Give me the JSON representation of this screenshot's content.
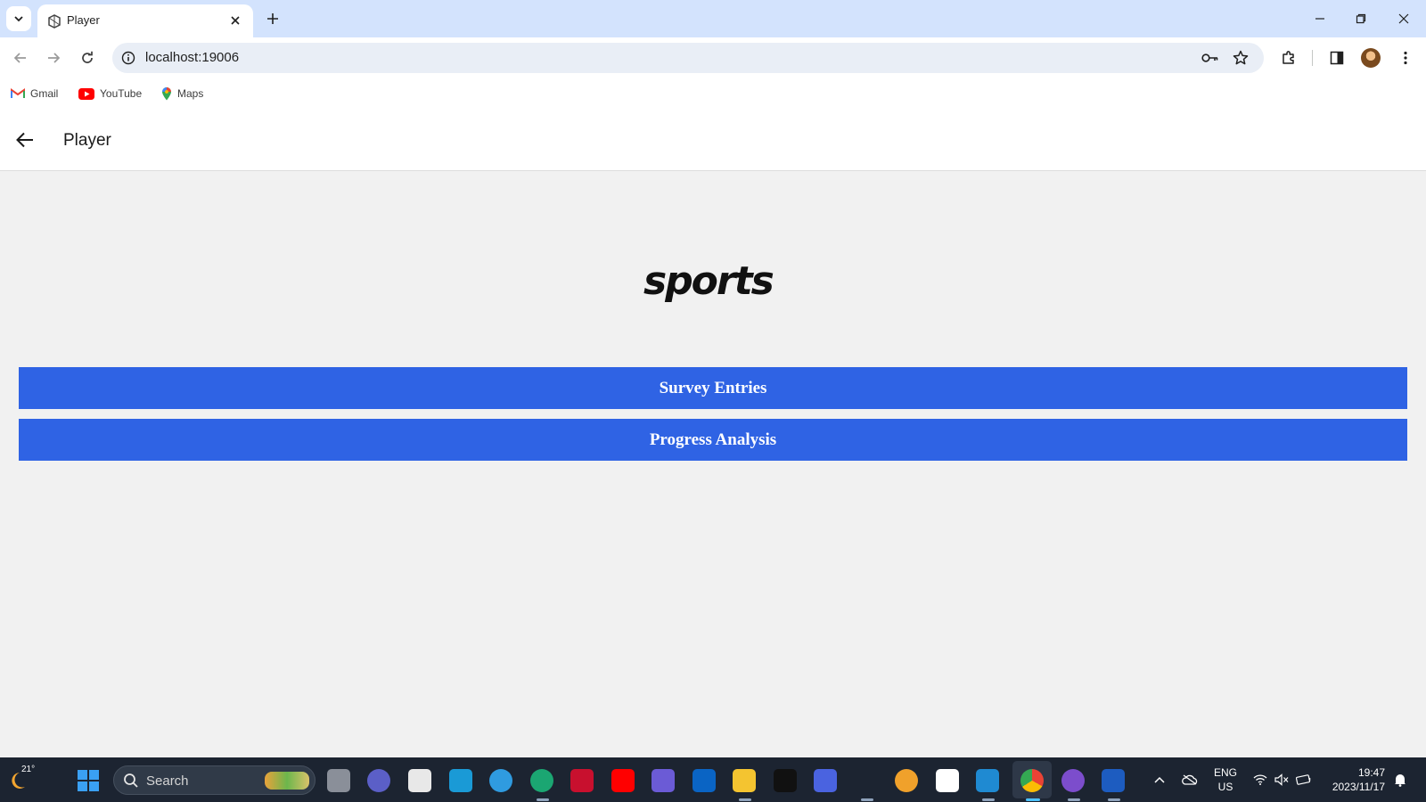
{
  "browser": {
    "tab_title": "Player",
    "url": "localhost:19006",
    "bookmarks": [
      {
        "label": "Gmail",
        "icon": "gmail-icon"
      },
      {
        "label": "YouTube",
        "icon": "youtube-icon"
      },
      {
        "label": "Maps",
        "icon": "maps-icon"
      }
    ]
  },
  "app": {
    "title": "Player",
    "logo_text": "sports",
    "buttons": {
      "survey": "Survey Entries",
      "progress": "Progress Analysis"
    },
    "colors": {
      "primary_button": "#2f63e4",
      "background": "#f1f1f1"
    }
  },
  "taskbar": {
    "temperature": "21°",
    "search_placeholder": "Search",
    "language_line1": "ENG",
    "language_line2": "US",
    "time": "19:47",
    "date": "2023/11/17"
  }
}
